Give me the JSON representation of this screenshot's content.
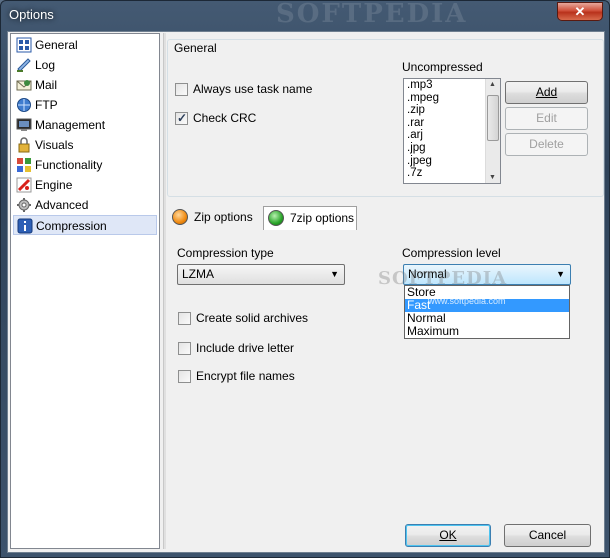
{
  "window": {
    "title": "Options",
    "close_glyph": "✕",
    "title_watermark": "SOFTPEDIA"
  },
  "sidebar": {
    "items": [
      {
        "label": "General",
        "icon": "general-icon"
      },
      {
        "label": "Log",
        "icon": "log-icon"
      },
      {
        "label": "Mail",
        "icon": "mail-icon"
      },
      {
        "label": "FTP",
        "icon": "ftp-icon"
      },
      {
        "label": "Management",
        "icon": "management-icon"
      },
      {
        "label": "Visuals",
        "icon": "visuals-icon"
      },
      {
        "label": "Functionality",
        "icon": "functionality-icon"
      },
      {
        "label": "Engine",
        "icon": "engine-icon"
      },
      {
        "label": "Advanced",
        "icon": "advanced-icon"
      },
      {
        "label": "Compression",
        "icon": "compression-icon"
      }
    ],
    "selected": "Compression"
  },
  "general_group": {
    "title": "General",
    "always_use_task_name": {
      "label": "Always use task name",
      "checked": false
    },
    "check_crc": {
      "label": "Check CRC",
      "checked": true
    },
    "uncompressed_label": "Uncompressed",
    "uncompressed_list": [
      ".mp3",
      ".mpeg",
      ".zip",
      ".rar",
      ".arj",
      ".jpg",
      ".jpeg",
      ".7z"
    ],
    "add_label": "Add",
    "edit_label": "Edit",
    "delete_label": "Delete"
  },
  "tabs": [
    {
      "label": "Zip options",
      "color": "#f08a10"
    },
    {
      "label": "7zip options",
      "color": "#2aa52a"
    }
  ],
  "compression": {
    "type_label": "Compression type",
    "type_value": "LZMA",
    "level_label": "Compression level",
    "level_value": "Normal",
    "level_options": [
      "Store",
      "Fast",
      "Normal",
      "Maximum"
    ],
    "level_highlighted": "Fast",
    "create_solid": {
      "label": "Create solid archives",
      "checked": false
    },
    "include_drive": {
      "label": "Include drive letter",
      "checked": false
    },
    "encrypt_names": {
      "label": "Encrypt file names",
      "checked": false
    }
  },
  "footer": {
    "ok_label": "OK",
    "cancel_label": "Cancel"
  },
  "watermark": {
    "text": "SOFTPEDIA",
    "url": "www.softpedia.com"
  }
}
